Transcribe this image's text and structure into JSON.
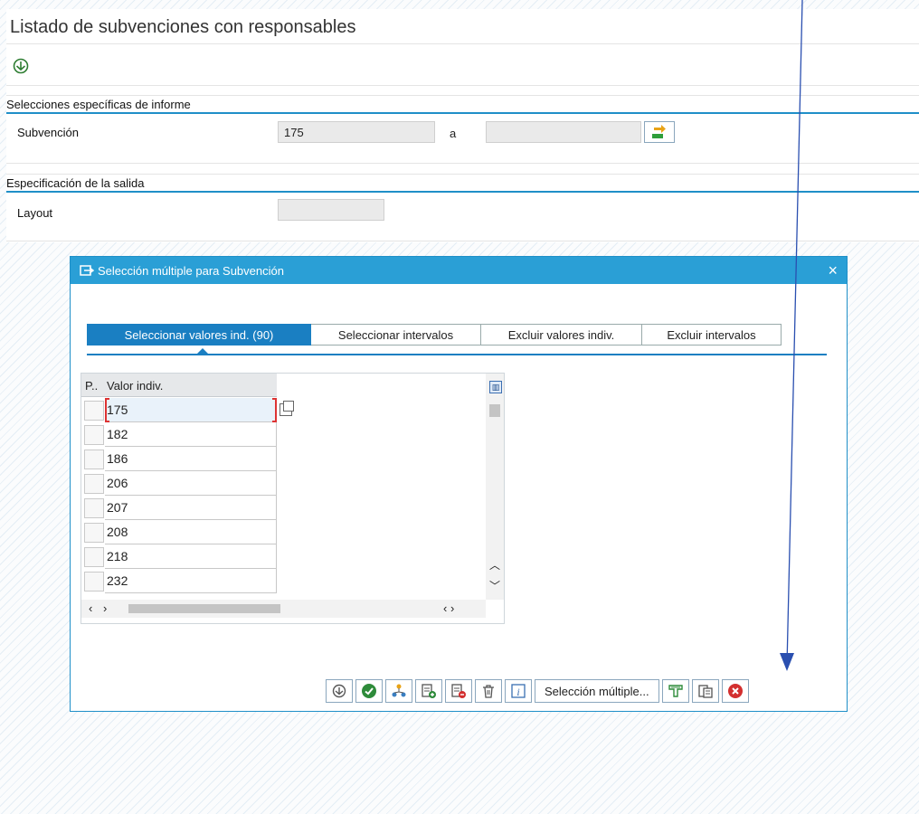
{
  "page": {
    "title": "Listado de subvenciones con responsables"
  },
  "selection_block": {
    "heading": "Selecciones específicas de informe",
    "field_label": "Subvención",
    "from_value": "175",
    "to_label": "a",
    "to_value": ""
  },
  "output_block": {
    "heading": "Especificación de la salida",
    "layout_label": "Layout",
    "layout_value": ""
  },
  "dialog": {
    "title": "Selección múltiple para Subvención",
    "close": "×",
    "tabs": [
      {
        "label": "Seleccionar valores ind. (90)",
        "active": true
      },
      {
        "label": "Seleccionar intervalos",
        "active": false
      },
      {
        "label": "Excluir valores indiv.",
        "active": false
      },
      {
        "label": "Excluir intervalos",
        "active": false
      }
    ],
    "grid": {
      "col_p": "P..",
      "col_value": "Valor indiv.",
      "rows": [
        "175",
        "182",
        "186",
        "206",
        "207",
        "208",
        "218",
        "232"
      ]
    },
    "toolbar": {
      "multi_selection_label": "Selección múltiple..."
    }
  },
  "colors": {
    "accent": "#2a9fd6",
    "tab_active": "#1a7fc2",
    "arrow": "#2a4fb0"
  }
}
